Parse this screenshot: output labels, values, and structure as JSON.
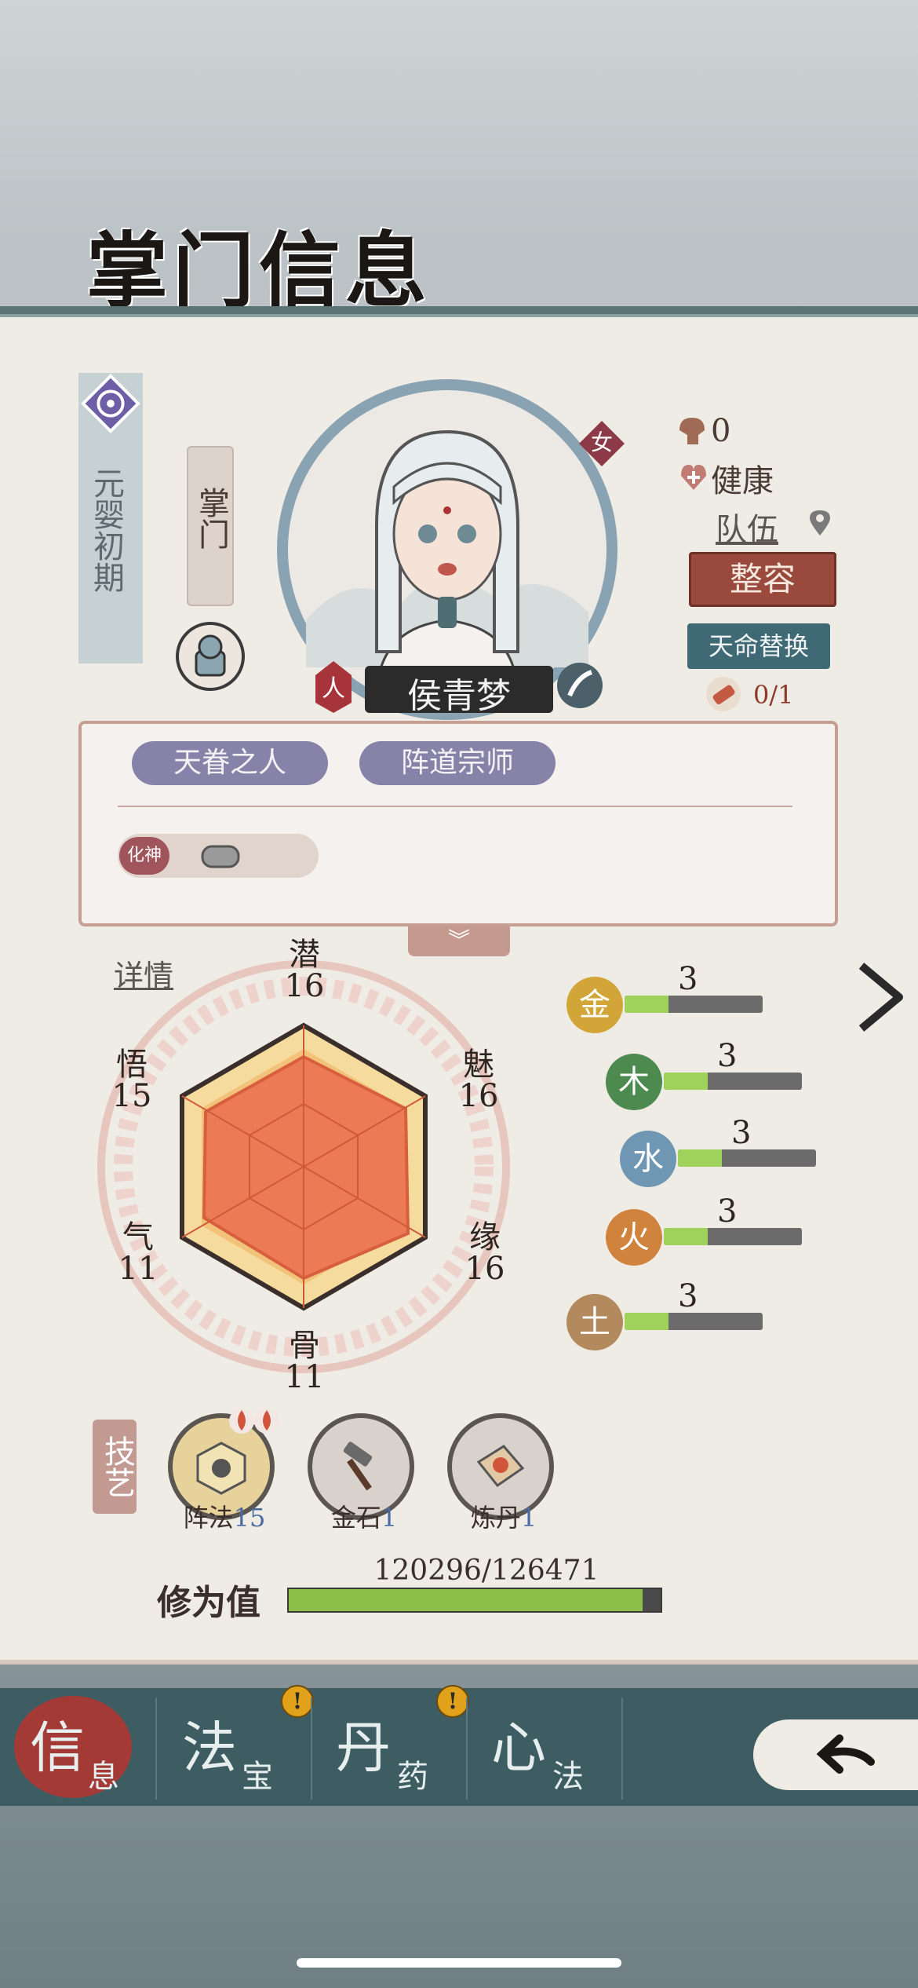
{
  "title": "掌门信息",
  "realm": "元婴初期",
  "role": "掌门",
  "character": {
    "name": "侯青梦",
    "gender": "女",
    "race": "人"
  },
  "status": {
    "kills": "0",
    "health": "健康",
    "team": "队伍",
    "tianming_count": "0/1"
  },
  "buttons": {
    "zhengrong": "整容",
    "tianming": "天命替换"
  },
  "traits": [
    "天眷之人",
    "阵道宗师"
  ],
  "huashen_tag": "化神",
  "detail_link": "详情",
  "attributes": {
    "qian": {
      "label": "潜",
      "value": "16"
    },
    "mei": {
      "label": "魅",
      "value": "16"
    },
    "yuan": {
      "label": "缘",
      "value": "16"
    },
    "gu": {
      "label": "骨",
      "value": "11"
    },
    "qi": {
      "label": "气",
      "value": "11"
    },
    "wu": {
      "label": "悟",
      "value": "15"
    }
  },
  "elements": [
    {
      "label": "金",
      "value": "3",
      "color": "#d1a537"
    },
    {
      "label": "木",
      "value": "3",
      "color": "#4d8a4f"
    },
    {
      "label": "水",
      "value": "3",
      "color": "#6f97b3"
    },
    {
      "label": "火",
      "value": "3",
      "color": "#d0833c"
    },
    {
      "label": "土",
      "value": "3",
      "color": "#b38a5e"
    }
  ],
  "skills_label": "技艺",
  "skills": [
    {
      "name": "阵法",
      "level": "15"
    },
    {
      "name": "金石",
      "level": "1"
    },
    {
      "name": "炼丹",
      "level": "1"
    }
  ],
  "xp": {
    "label": "修为值",
    "text": "120296/126471",
    "fraction": 0.951
  },
  "nav": [
    {
      "big": "信",
      "small": "息"
    },
    {
      "big": "法",
      "small": "宝"
    },
    {
      "big": "丹",
      "small": "药"
    },
    {
      "big": "心",
      "small": "法"
    }
  ],
  "alert_mark": "!"
}
